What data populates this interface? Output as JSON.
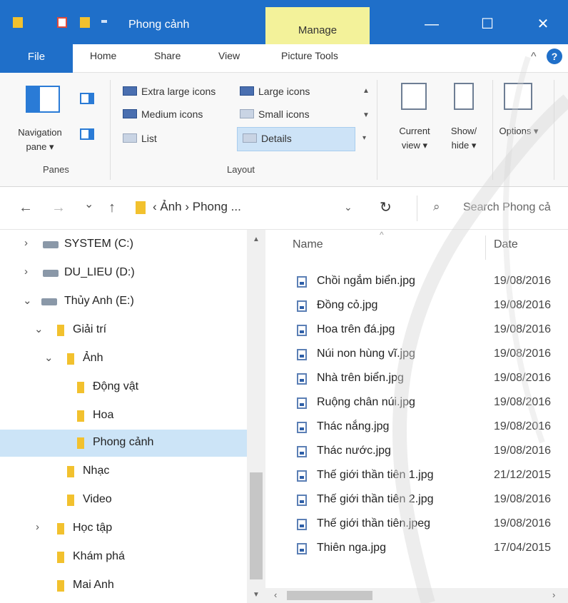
{
  "window": {
    "title": "Phong cảnh",
    "context_tab": "Manage",
    "minimize_glyph": "—",
    "maximize_glyph": "☐",
    "close_glyph": "✕"
  },
  "ribbon_tabs": {
    "file": "File",
    "home": "Home",
    "share": "Share",
    "view": "View",
    "picture_tools": "Picture Tools",
    "collapse_glyph": "^",
    "help_glyph": "?"
  },
  "panes": {
    "navigation_pane": "Navigation pane ▾",
    "group_label": "Panes"
  },
  "layout": {
    "group_label": "Layout",
    "items": {
      "extra_large": "Extra large icons",
      "large": "Large icons",
      "medium": "Medium icons",
      "small": "Small icons",
      "list": "List",
      "details": "Details"
    },
    "selected": "Details"
  },
  "view_buttons": {
    "current_view": "Current view ▾",
    "show_hide": "Show/ hide ▾",
    "options": "Options ▾"
  },
  "address": {
    "back": "←",
    "forward": "→",
    "recent": "⌄",
    "up": "↑",
    "path": "‹ Ảnh › Phong ...",
    "dropdown": "⌄",
    "refresh": "↻",
    "search_placeholder": "Search Phong cả",
    "search_icon": "magnifier-icon"
  },
  "nav_tree": [
    {
      "label": "SYSTEM (C:)",
      "kind": "drive",
      "chevron": "›"
    },
    {
      "label": "DU_LIEU (D:)",
      "kind": "drive",
      "chevron": "›"
    },
    {
      "label": "Thủy Anh (E:)",
      "kind": "drive",
      "chevron": "⌄"
    },
    {
      "label": "Giải trí",
      "kind": "folder",
      "chevron": "⌄"
    },
    {
      "label": "Ảnh",
      "kind": "folder",
      "chevron": "⌄"
    },
    {
      "label": "Động vật",
      "kind": "folder",
      "chevron": ""
    },
    {
      "label": "Hoa",
      "kind": "folder",
      "chevron": ""
    },
    {
      "label": "Phong cảnh",
      "kind": "folder",
      "chevron": "",
      "selected": true
    },
    {
      "label": "Nhạc",
      "kind": "folder",
      "chevron": ""
    },
    {
      "label": "Video",
      "kind": "folder",
      "chevron": ""
    },
    {
      "label": "Học tập",
      "kind": "folder",
      "chevron": "›"
    },
    {
      "label": "Khám phá",
      "kind": "folder",
      "chevron": ""
    },
    {
      "label": "Mai Anh",
      "kind": "folder",
      "chevron": ""
    }
  ],
  "file_list": {
    "columns": {
      "name": "Name",
      "date": "Date"
    },
    "files": [
      {
        "name": "Chồi ngắm biển.jpg",
        "date": "19/08/2016"
      },
      {
        "name": "Đồng cỏ.jpg",
        "date": "19/08/2016"
      },
      {
        "name": "Hoa trên đá.jpg",
        "date": "19/08/2016"
      },
      {
        "name": "Núi non hùng vĩ.jpg",
        "date": "19/08/2016"
      },
      {
        "name": "Nhà trên biển.jpg",
        "date": "19/08/2016"
      },
      {
        "name": "Ruộng chân núi.jpg",
        "date": "19/08/2016"
      },
      {
        "name": "Thác nắng.jpg",
        "date": "19/08/2016"
      },
      {
        "name": "Thác nước.jpg",
        "date": "19/08/2016"
      },
      {
        "name": "Thế giới thần tiên 1.jpg",
        "date": "21/12/2015"
      },
      {
        "name": "Thế giới thần tiên 2.jpg",
        "date": "19/08/2016"
      },
      {
        "name": "Thế giới thần tiên.jpeg",
        "date": "19/08/2016"
      },
      {
        "name": "Thiên nga.jpg",
        "date": "17/04/2015"
      }
    ]
  },
  "colors": {
    "titlebar": "#1f6fc9",
    "manage_tab": "#f3f29a",
    "selection": "#cce4f7",
    "folder": "#f2c12e"
  }
}
